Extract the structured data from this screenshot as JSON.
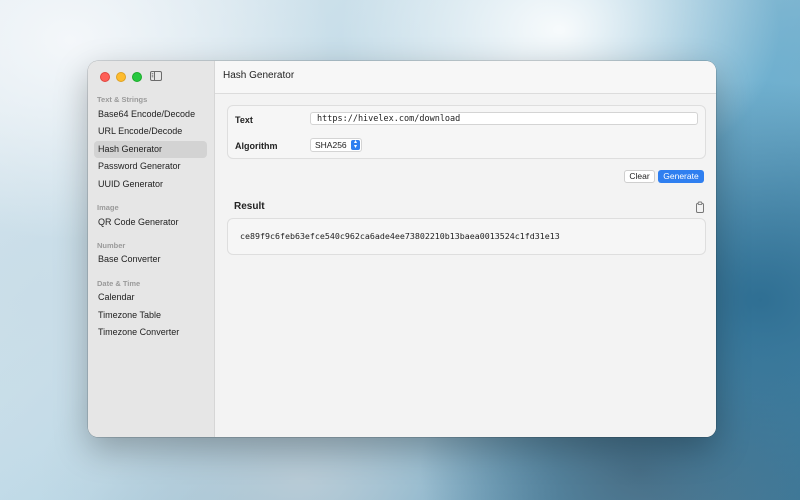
{
  "sidebar": {
    "sections": [
      {
        "title": "Text & Strings",
        "items": [
          "Base64 Encode/Decode",
          "URL Encode/Decode",
          "Hash Generator",
          "Password Generator",
          "UUID Generator"
        ]
      },
      {
        "title": "Image",
        "items": [
          "QR Code Generator"
        ]
      },
      {
        "title": "Number",
        "items": [
          "Base Converter"
        ]
      },
      {
        "title": "Date & Time",
        "items": [
          "Calendar",
          "Timezone Table",
          "Timezone Converter"
        ]
      }
    ],
    "selected": "Hash Generator"
  },
  "main": {
    "title": "Hash Generator",
    "form": {
      "text_label": "Text",
      "text_value": "https://hivelex.com/download",
      "algorithm_label": "Algorithm",
      "algorithm_value": "SHA256"
    },
    "buttons": {
      "clear": "Clear",
      "generate": "Generate"
    },
    "result": {
      "label": "Result",
      "value": "ce89f9c6feb63efce540c962ca6ade4ee73802210b13baea0013524c1fd31e13"
    }
  },
  "colors": {
    "accent": "#2f7ff0",
    "close": "#fe5f57",
    "minimize": "#febc2e",
    "zoom": "#28c840"
  },
  "icons": {
    "sidebar_toggle": "sidebar-toggle-icon",
    "copy": "copy-icon",
    "select_arrows": "chevron-up-down-icon"
  }
}
